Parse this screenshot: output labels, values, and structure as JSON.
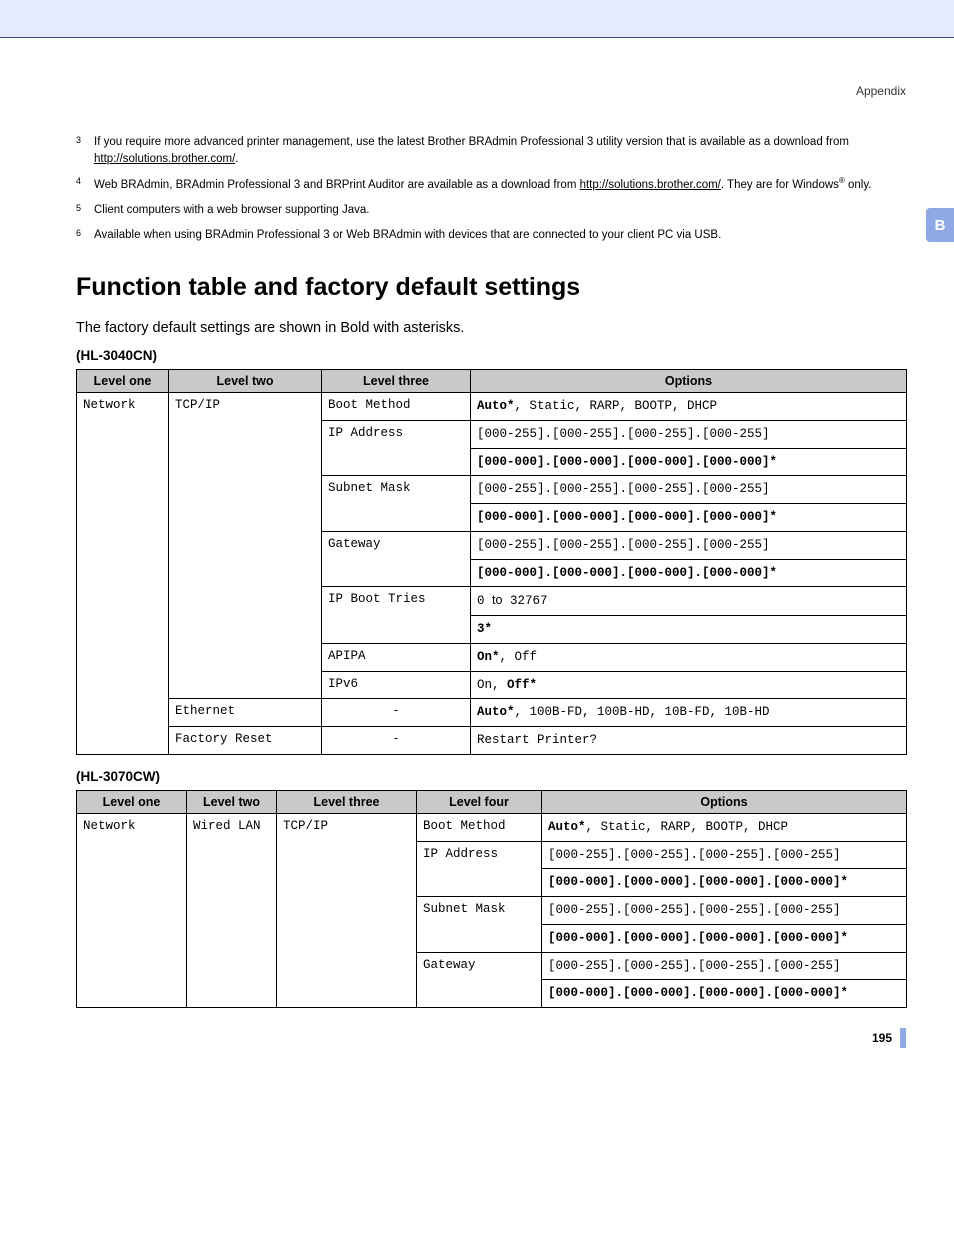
{
  "header": {
    "section": "Appendix",
    "tab": "B"
  },
  "footnotes": [
    {
      "n": "3",
      "html": "If you require more advanced printer management, use the latest Brother BRAdmin Professional 3 utility version that is available as a download from <a href='#'>http://solutions.brother.com/</a>."
    },
    {
      "n": "4",
      "html": "Web BRAdmin, BRAdmin Professional 3 and BRPrint Auditor are available as a download from <a href='#'>http://solutions.brother.com/</a>. They are for Windows<sup>®</sup> only."
    },
    {
      "n": "5",
      "html": "Client computers with a web browser supporting Java."
    },
    {
      "n": "6",
      "html": "Available when using BRAdmin Professional 3 or Web BRAdmin with devices that are connected to your client PC via USB."
    }
  ],
  "title": "Function table and factory default settings",
  "intro": "The factory default settings are shown in Bold with asterisks.",
  "model1": "(HL-3040CN)",
  "model2": "(HL-3070CW)",
  "t1": {
    "cols": [
      "Level one",
      "Level two",
      "Level three",
      "Options"
    ],
    "widths": [
      "92",
      "153",
      "149",
      "436"
    ],
    "rows": [
      {
        "c1r": 9,
        "c1": "Network",
        "c2r": 7,
        "c2": "TCP/IP",
        "c3": "Boot Method",
        "opt": "<b>Auto*</b>, Static, RARP, BOOTP, DHCP"
      },
      {
        "c3r": 2,
        "c3": "IP Address",
        "opt": "[000-255].[000-255].[000-255].[000-255]"
      },
      {
        "opt": "<b>[000-000].[000-000].[000-000].[000-000]*</b>"
      },
      {
        "c3r": 2,
        "c3": "Subnet Mask",
        "opt": "[000-255].[000-255].[000-255].[000-255]"
      },
      {
        "opt": "<b>[000-000].[000-000].[000-000].[000-000]*</b>"
      },
      {
        "c3r": 2,
        "c3": "Gateway",
        "opt": "[000-255].[000-255].[000-255].[000-255]"
      },
      {
        "opt": "<b>[000-000].[000-000].[000-000].[000-000]*</b>"
      }
    ],
    "rows2": [
      {
        "c3r": 2,
        "c3": "IP Boot Tries",
        "opt": "0 <span class='sans'>to</span> 32767"
      },
      {
        "opt": "<b>3*</b>"
      },
      {
        "c3": "APIPA",
        "opt": "<b>On*</b>, Off"
      },
      {
        "c3": "IPv6",
        "opt": "On, <b>Off*</b>"
      },
      {
        "c2": "Ethernet",
        "c3": "-",
        "c3c": true,
        "opt": "<b>Auto*</b>, 100B-FD, 100B-HD, 10B-FD, 10B-HD"
      },
      {
        "c2": "Factory Reset",
        "c3": "-",
        "c3c": true,
        "opt": "Restart Printer?"
      }
    ]
  },
  "t2": {
    "cols": [
      "Level one",
      "Level two",
      "Level three",
      "Level four",
      "Options"
    ],
    "widths": [
      "110",
      "90",
      "140",
      "125",
      "365"
    ],
    "rows": [
      {
        "c1r": 7,
        "c1": "Network",
        "c2r": 7,
        "c2": "Wired LAN",
        "c3r": 7,
        "c3": "TCP/IP",
        "c4": "Boot Method",
        "opt": "<b>Auto*</b>, Static, RARP, BOOTP, DHCP"
      },
      {
        "c4r": 2,
        "c4": "IP Address",
        "opt": "[000-255].[000-255].[000-255].[000-255]"
      },
      {
        "opt": "<b>[000-000].[000-000].[000-000].[000-000]*</b>"
      },
      {
        "c4r": 2,
        "c4": "Subnet Mask",
        "opt": "[000-255].[000-255].[000-255].[000-255]"
      },
      {
        "opt": "<b>[000-000].[000-000].[000-000].[000-000]*</b>"
      },
      {
        "c4r": 2,
        "c4": "Gateway",
        "opt": "[000-255].[000-255].[000-255].[000-255]"
      },
      {
        "opt": "<b>[000-000].[000-000].[000-000].[000-000]*</b>"
      }
    ]
  },
  "pageNumber": "195"
}
